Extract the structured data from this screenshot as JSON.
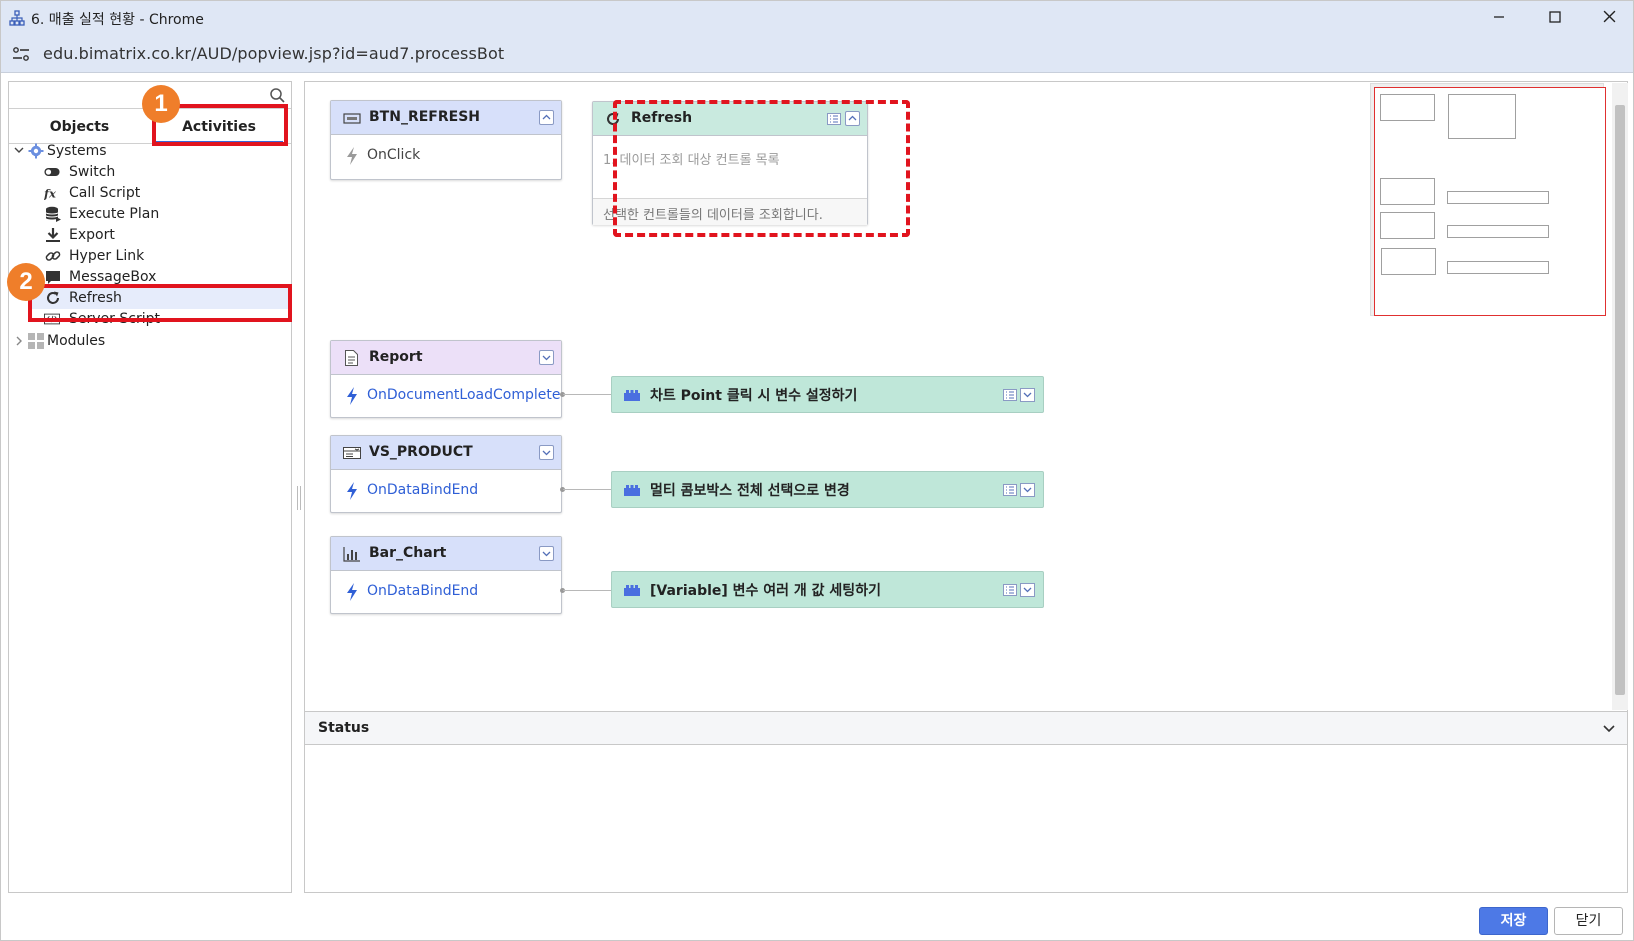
{
  "window": {
    "title": "6. 매출 실적 현황 - Chrome",
    "minimize_icon": "minimize-icon",
    "maximize_icon": "maximize-icon",
    "close_icon": "close-icon"
  },
  "address": {
    "url": "edu.bimatrix.co.kr/AUD/popview.jsp?id=aud7.processBot"
  },
  "left": {
    "search_placeholder": "",
    "tabs": [
      {
        "label": "Objects",
        "active": false
      },
      {
        "label": "Activities",
        "active": true
      }
    ],
    "tree": [
      {
        "label": "Systems",
        "icon": "gear-icon",
        "expanded": true,
        "level": 0
      },
      {
        "label": "Switch",
        "icon": "toggle-icon",
        "level": 1
      },
      {
        "label": "Call Script",
        "icon": "function-icon",
        "level": 1
      },
      {
        "label": "Execute Plan",
        "icon": "database-icon",
        "level": 1
      },
      {
        "label": "Export",
        "icon": "download-icon",
        "level": 1
      },
      {
        "label": "Hyper Link",
        "icon": "link-icon",
        "level": 1
      },
      {
        "label": "MessageBox",
        "icon": "message-icon",
        "level": 1
      },
      {
        "label": "Refresh",
        "icon": "refresh-icon",
        "level": 1,
        "selected": true
      },
      {
        "label": "Server Script",
        "icon": "code-icon",
        "level": 1
      },
      {
        "label": "Modules",
        "icon": "grid-icon",
        "expanded": false,
        "level": 0
      }
    ]
  },
  "canvas": {
    "nodes": [
      {
        "name": "BTN_REFRESH",
        "icon": "button-icon",
        "event": "OnClick",
        "event_linked": false
      },
      {
        "name": "Report",
        "icon": "document-icon",
        "event": "OnDocumentLoadComplete",
        "event_linked": true
      },
      {
        "name": "VS_PRODUCT",
        "icon": "combobox-icon",
        "event": "OnDataBindEnd",
        "event_linked": true
      },
      {
        "name": "Bar_Chart",
        "icon": "bar-chart-icon",
        "event": "OnDataBindEnd",
        "event_linked": true
      }
    ],
    "refresh_node": {
      "name": "Refresh",
      "item": "1. 데이터 조회 대상 컨트롤 목록",
      "description": "선택한 컨트롤들의 데이터를 조회합니다."
    },
    "actions": [
      {
        "label": "차트 Point 클릭 시 변수 설정하기",
        "icon": "module-icon"
      },
      {
        "label": "멀티 콤보박스 전체 선택으로 변경",
        "icon": "module-icon"
      },
      {
        "label": "[Variable] 변수 여러 개 값 세팅하기",
        "icon": "module-icon"
      }
    ]
  },
  "status": {
    "label": "Status"
  },
  "buttons": {
    "save": "저장",
    "close": "닫기"
  },
  "annotations": {
    "badge1": "1",
    "badge2": "2"
  },
  "colors": {
    "accent": "#4d79e6",
    "highlight": "#e1141e",
    "badge": "#ef7e2a",
    "event_link": "#2f5fd6",
    "action_bg": "#bfe7d9"
  }
}
